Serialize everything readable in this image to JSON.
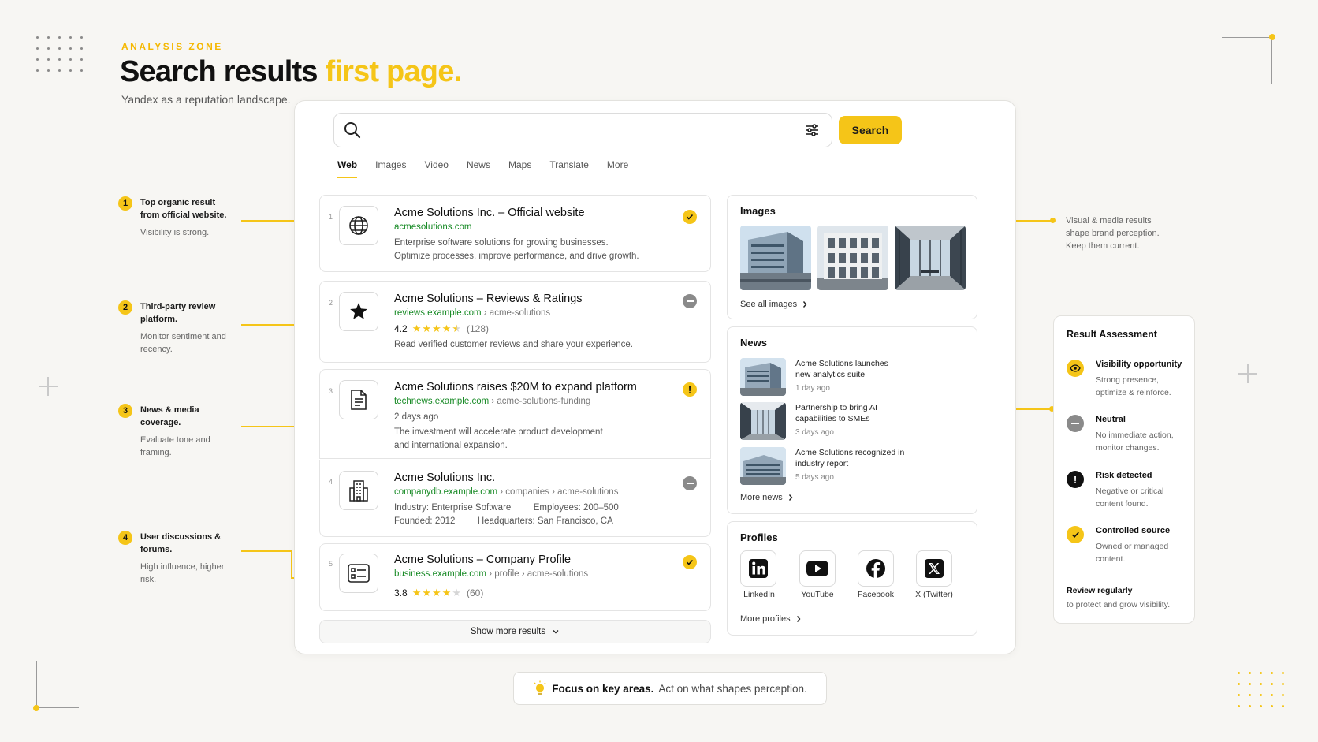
{
  "header": {
    "eyebrow": "ANALYSIS ZONE",
    "title_main": "Search results",
    "title_highlight": "first page.",
    "subtitle": "Yandex as a reputation landscape."
  },
  "annotations": [
    {
      "num": "1",
      "title": "Top organic result from official website.",
      "subtitle": "Visibility is strong."
    },
    {
      "num": "2",
      "title": "Third-party review platform.",
      "subtitle": "Monitor sentiment and recency."
    },
    {
      "num": "3",
      "title": "News & media coverage.",
      "subtitle": "Evaluate tone and framing."
    },
    {
      "num": "4",
      "title": "User discussions & forums.",
      "subtitle": "High influence, higher risk."
    }
  ],
  "right_note": "Visual & media results shape brand perception. Keep them current.",
  "search": {
    "placeholder": "",
    "button_label": "Search",
    "tabs": [
      "Web",
      "Images",
      "Video",
      "News",
      "Maps",
      "Translate",
      "More"
    ]
  },
  "results": [
    {
      "num": "1",
      "title": "Acme Solutions Inc. – Official website",
      "url": "acmesolutions.com",
      "path": "",
      "lines": [
        "Enterprise software solutions for growing businesses.",
        "Optimize processes, improve performance, and drive growth."
      ],
      "status": "check"
    },
    {
      "num": "2",
      "title": "Acme Solutions – Reviews & Ratings",
      "url": "reviews.example.com",
      "path": "› acme-solutions",
      "rating": "4.2",
      "reviews": "(128)",
      "lines": [
        "Read verified customer reviews and share your experience."
      ],
      "status": "neutral"
    },
    {
      "num": "3",
      "title": "Acme Solutions raises $20M to expand platform",
      "url": "technews.example.com",
      "path": "› acme-solutions-funding",
      "date": "2 days ago",
      "lines": [
        "The investment will accelerate product development",
        "and international expansion."
      ],
      "status": "warning"
    },
    {
      "num": "4",
      "title": "Acme Solutions Inc.",
      "url": "companydb.example.com",
      "path": "› companies › acme-solutions",
      "details": [
        {
          "label": "Industry:",
          "value": "Enterprise Software"
        },
        {
          "label": "Employees:",
          "value": "200–500"
        },
        {
          "label": "Founded:",
          "value": "2012"
        },
        {
          "label": "Headquarters:",
          "value": "San Francisco, CA"
        }
      ],
      "status": "neutral"
    },
    {
      "num": "5",
      "title": "Acme Solutions – Company Profile",
      "url": "business.example.com",
      "path": "› profile › acme-solutions",
      "rating": "3.8",
      "reviews": "(60)",
      "status": "check"
    }
  ],
  "show_more": "Show more results",
  "images_block": {
    "title": "Images",
    "more": "See all images"
  },
  "news_block": {
    "title": "News",
    "items": [
      {
        "title": "Acme Solutions launches new analytics suite",
        "date": "1 day ago"
      },
      {
        "title": "Partnership to bring AI capabilities to SMEs",
        "date": "3 days ago"
      },
      {
        "title": "Acme Solutions recognized in industry report",
        "date": "5 days ago"
      }
    ],
    "more": "More news"
  },
  "profiles_block": {
    "title": "Profiles",
    "items": [
      {
        "label": "LinkedIn",
        "icon": "linkedin-icon"
      },
      {
        "label": "YouTube",
        "icon": "youtube-icon"
      },
      {
        "label": "Facebook",
        "icon": "facebook-icon"
      },
      {
        "label": "X (Twitter)",
        "icon": "x-twitter-icon"
      }
    ],
    "more": "More profiles"
  },
  "legend": {
    "title": "Result Assessment",
    "items": [
      {
        "title": "Visibility opportunity",
        "subtitle": "Strong presence, optimize & reinforce."
      },
      {
        "title": "Neutral",
        "subtitle": "No immediate action, monitor changes."
      },
      {
        "title": "Risk detected",
        "subtitle": "Negative or critical content found."
      },
      {
        "title": "Controlled source",
        "subtitle": "Owned or managed content."
      }
    ],
    "footer_title": "Review regularly",
    "footer_sub": "to protect and grow visibility."
  },
  "footer": {
    "bold": "Focus on key areas.",
    "text": "Act on what shapes perception."
  },
  "colors": {
    "accent": "#f5c518",
    "url_green": "#178a25",
    "neutral_gray": "#8a8a8a",
    "background": "#f7f6f3"
  }
}
